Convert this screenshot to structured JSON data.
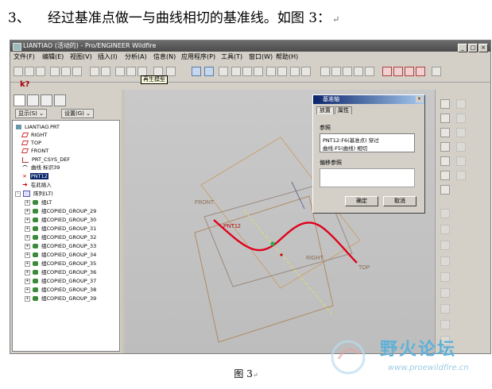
{
  "heading": {
    "number": "3、",
    "text": "经过基准点做一与曲线相切的基准线。如图 3：",
    "para_mark": "↵"
  },
  "window": {
    "title": "LIANTIAO (活动的) - Pro/ENGINEER Wildfire",
    "menu": [
      "文件(F)",
      "编辑(E)",
      "视图(V)",
      "插入(I)",
      "分析(A)",
      "信息(N)",
      "应用程序(P)",
      "工具(T)",
      "窗口(W)",
      "帮助(H)"
    ],
    "tooltip": "再生模型"
  },
  "left_panel": {
    "show_button": "显示(S)",
    "settings_button": "设置(G)",
    "tree": [
      {
        "label": "LIANTIAO.PRT",
        "icon": "part-icon"
      },
      {
        "label": "RIGHT",
        "icon": "datum-plane-icon"
      },
      {
        "label": "TOP",
        "icon": "datum-plane-icon"
      },
      {
        "label": "FRONT",
        "icon": "datum-plane-icon"
      },
      {
        "label": "PRT_CSYS_DEF",
        "icon": "csys-icon"
      },
      {
        "label": "曲线 标识39",
        "icon": "curve-icon"
      },
      {
        "label": "PNT12",
        "icon": "datum-point-icon",
        "selected": true
      },
      {
        "label": "在此插入",
        "icon": "insert-arrow-icon"
      },
      {
        "label": "阵列(LT)",
        "icon": "pattern-icon"
      },
      {
        "label": "组LT",
        "icon": "group-icon"
      },
      {
        "label": "组COPIED_GROUP_29",
        "icon": "group-icon"
      },
      {
        "label": "组COPIED_GROUP_30",
        "icon": "group-icon"
      },
      {
        "label": "组COPIED_GROUP_31",
        "icon": "group-icon"
      },
      {
        "label": "组COPIED_GROUP_32",
        "icon": "group-icon"
      },
      {
        "label": "组COPIED_GROUP_33",
        "icon": "group-icon"
      },
      {
        "label": "组COPIED_GROUP_34",
        "icon": "group-icon"
      },
      {
        "label": "组COPIED_GROUP_35",
        "icon": "group-icon"
      },
      {
        "label": "组COPIED_GROUP_36",
        "icon": "group-icon"
      },
      {
        "label": "组COPIED_GROUP_37",
        "icon": "group-icon"
      },
      {
        "label": "组COPIED_GROUP_38",
        "icon": "group-icon"
      },
      {
        "label": "组COPIED_GROUP_39",
        "icon": "group-icon"
      }
    ]
  },
  "viewport": {
    "labels": {
      "front": "FRONT",
      "pnt": "PNT12",
      "right": "RIGHT",
      "top": "TOP"
    }
  },
  "dialog": {
    "title": "基准轴",
    "tabs": [
      "放置",
      "属性"
    ],
    "refs_label": "参照",
    "refs": [
      "PNT12:F6(基准点)  穿过",
      "曲线:F5(曲线)      相切"
    ],
    "offset_label": "偏移参照",
    "ok": "确定",
    "cancel": "取消"
  },
  "watermark": {
    "name": "野火论坛",
    "url": "www.proewildfire.cn"
  },
  "caption": {
    "text": "图 3",
    "para_mark": "↵"
  },
  "colors": {
    "curve": "#e0001a",
    "accent": "#0a246a"
  }
}
